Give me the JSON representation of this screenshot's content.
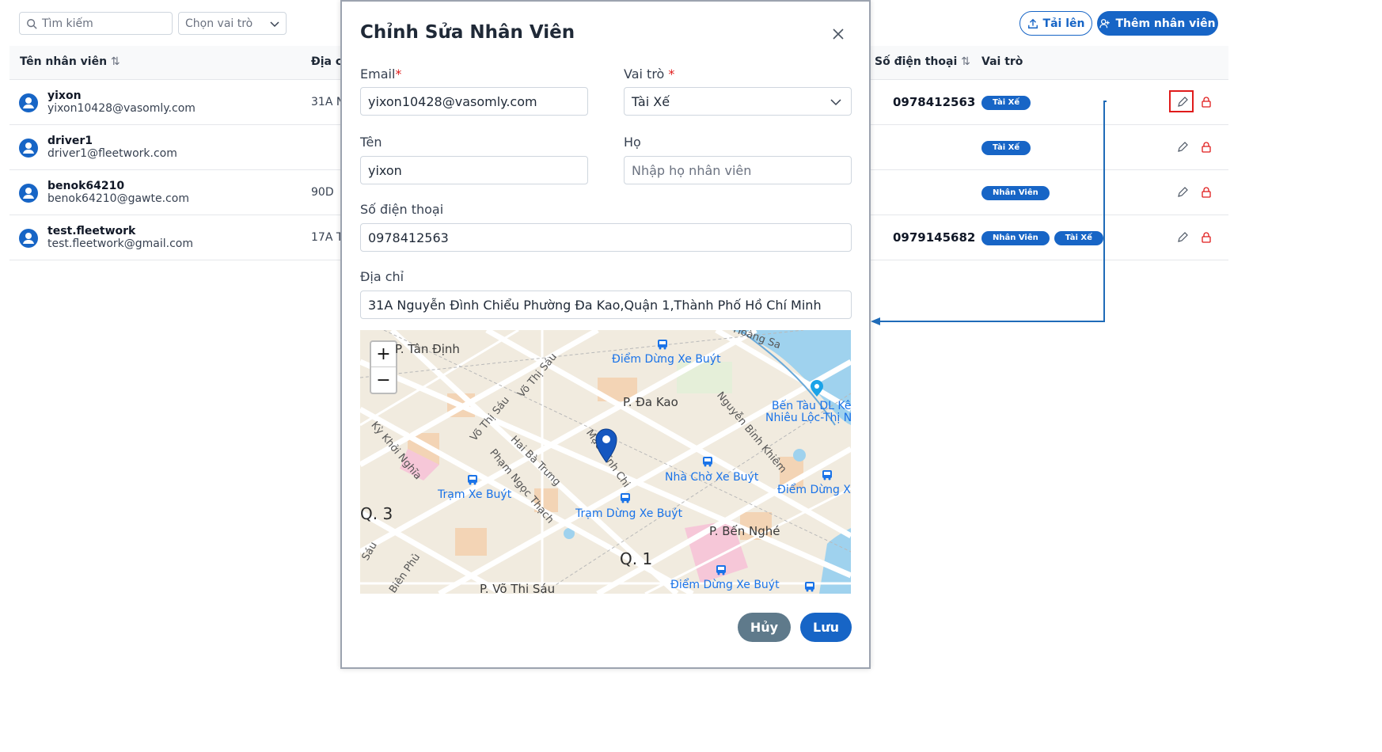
{
  "toolbar": {
    "search_placeholder": "Tìm kiếm",
    "role_filter_placeholder": "Chọn vai trò",
    "upload_label": "Tải lên",
    "add_employee_label": "Thêm nhân viên"
  },
  "table": {
    "headers": {
      "name": "Tên nhân viên",
      "address": "Địa c",
      "phone": "Số điện thoại",
      "role": "Vai trò"
    },
    "rows": [
      {
        "name": "yixon",
        "email": "yixon10428@vasomly.com",
        "address": "31A N",
        "phone": "0978412563",
        "roles": [
          "Tài Xế"
        ]
      },
      {
        "name": "driver1",
        "email": "driver1@fleetwork.com",
        "address": "",
        "phone": "",
        "roles": [
          "Tài Xế"
        ]
      },
      {
        "name": "benok64210",
        "email": "benok64210@gawte.com",
        "address": "90D",
        "phone": "",
        "roles": [
          "Nhân Viên"
        ]
      },
      {
        "name": "test.fleetwork",
        "email": "test.fleetwork@gmail.com",
        "address": "17A T",
        "phone": "0979145682",
        "roles": [
          "Nhân Viên",
          "Tài Xế"
        ]
      }
    ]
  },
  "modal": {
    "title": "Chỉnh Sửa Nhân Viên",
    "email_label": "Email",
    "email_value": "yixon10428@vasomly.com",
    "role_label": "Vai trò",
    "role_value": "Tài Xế",
    "first_name_label": "Tên",
    "first_name_value": "yixon",
    "last_name_label": "Họ",
    "last_name_placeholder": "Nhập họ nhân viên",
    "phone_label": "Số điện thoại",
    "phone_value": "0978412563",
    "address_label": "Địa chỉ",
    "address_value": "31A Nguyễn Đình Chiểu Phường Đa Kao,Quận 1,Thành Phố Hồ Chí Minh",
    "required_mark": "*",
    "cancel_label": "Hủy",
    "save_label": "Lưu",
    "map": {
      "zoom_in": "+",
      "zoom_out": "−",
      "labels": {
        "tan_dinh": "P. Tân Định",
        "bus_stop_1": "Điểm Dừng Xe Buýt",
        "da_kao": "P. Đa Kao",
        "vo_thi_sau_1": "Võ Thị Sáu",
        "vo_thi_sau_2": "Võ Thị Sáu",
        "hai_ba_trung": "Hai Bà Trưng",
        "pham_ngoc_thach": "Phạm Ngọc Thạch",
        "ky_khoi_nghia": "Kỳ Khởi Nghĩa",
        "nguyen_binh_khiem": "Nguyễn Bỉnh Khiêm",
        "mac_dinh_chi": "Mạc Đĩnh Chi",
        "ben_tau_1": "Bến Tàu DL Kênh",
        "ben_tau_2": "Nhiêu Lộc-Thị Nghè",
        "hoang_sa": "Hoàng Sa",
        "nha_cho": "Nhà Chờ Xe Buýt",
        "tram_xe_buyt": "Trạm Xe Buýt",
        "diem_dung_2": "Điểm Dừng Xe",
        "q3": "Q. 3",
        "tram_dung": "Trạm Dừng Xe Buýt",
        "ben_nghe": "P. Bến Nghé",
        "q1": "Q. 1",
        "bien_phu": "Biên Phủ",
        "vo_thi_sau_ward": "P. Võ Thị Sáu",
        "diem_dung_3": "Điểm Dừng Xe Buýt",
        "sau_edge": "Sáu"
      }
    }
  },
  "colors": {
    "primary": "#1765c6",
    "cancel": "#5f7a8b",
    "danger": "#e01b1b",
    "map_bg": "#f0e9dc"
  },
  "icons": [
    "search-icon",
    "chevron-down-icon",
    "upload-icon",
    "add-user-icon",
    "sort-icon",
    "user-avatar-icon",
    "pencil-icon",
    "lock-icon",
    "close-icon",
    "map-pin-icon",
    "bus-icon",
    "anchor-icon"
  ]
}
